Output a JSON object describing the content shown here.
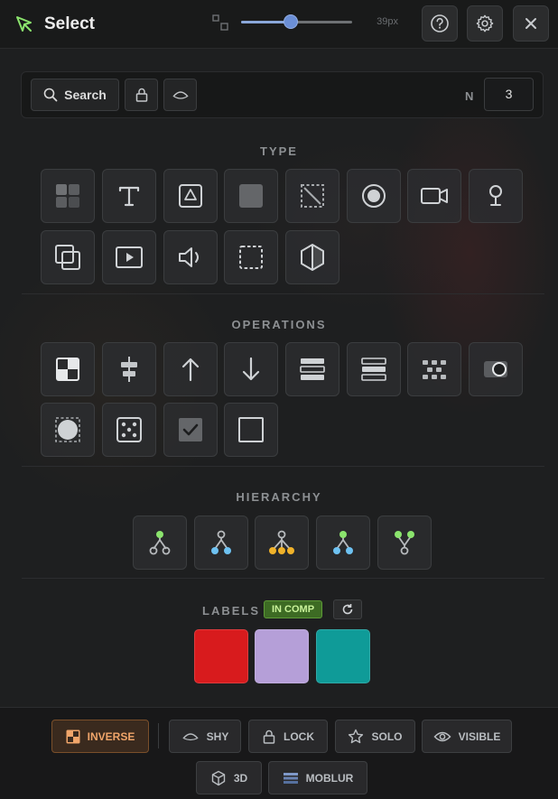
{
  "header": {
    "title": "Select",
    "title_icon": "cursor-arrow-icon",
    "zoom_icon": "zoom-squares-icon",
    "slider_value_label": "39px",
    "slider_fraction": 0.45,
    "buttons": [
      {
        "name": "help-button",
        "icon": "question-circle-icon"
      },
      {
        "name": "settings-button",
        "icon": "gear-icon"
      },
      {
        "name": "close-button",
        "icon": "close-icon"
      }
    ]
  },
  "search": {
    "label": "Search",
    "lock_icon": "lock-icon",
    "visibility_icon": "eye-closed-icon",
    "n_label": "N",
    "n_value": "3"
  },
  "sections": {
    "type": "TYPE",
    "operations": "OPERATIONS",
    "hierarchy": "HIERARCHY",
    "labels": "LABELS"
  },
  "type_tiles": [
    "precomp-icon",
    "text-layer-icon",
    "shape-layer-icon",
    "solid-layer-icon",
    "null-layer-icon",
    "adjustment-layer-icon",
    "camera-icon",
    "light-icon",
    "composition-icon",
    "video-footage-icon",
    "audio-icon",
    "guide-layer-icon",
    "3d-model-icon"
  ],
  "operation_tiles": [
    "invert-selection-icon",
    "align-center-icon",
    "select-above-icon",
    "select-below-icon",
    "select-layers-stack-icon",
    "select-layers-stack-alt-icon",
    "grid-dots-icon",
    "toggle-icon",
    "select-circle-icon",
    "random-dice-icon",
    "checkbox-checked-icon",
    "checkbox-empty-icon"
  ],
  "hierarchy_tiles": [
    "parent-node-icon",
    "children-node-icon",
    "all-children-icon",
    "siblings-node-icon",
    "root-merge-icon"
  ],
  "labels": {
    "badge": "IN COMP",
    "refresh_icon": "refresh-icon",
    "swatches": [
      "#d81b1d",
      "#b59fd8",
      "#0f9b98"
    ]
  },
  "colors": {
    "accent_green": "#8be46d",
    "accent_blue": "#6ec2f2",
    "accent_gold": "#f0b22a",
    "active_orange": "#f0a56a"
  },
  "bottom": {
    "row1": [
      {
        "label": "INVERSE",
        "icon": "inverse-icon",
        "active": true
      },
      {
        "label": "SHY",
        "icon": "shy-icon",
        "active": false
      },
      {
        "label": "LOCK",
        "icon": "lock-icon",
        "active": false
      },
      {
        "label": "SOLO",
        "icon": "star-icon",
        "active": false
      },
      {
        "label": "VISIBLE",
        "icon": "eye-icon",
        "active": false
      }
    ],
    "row2": [
      {
        "label": "3D",
        "icon": "cube-icon",
        "active": false
      },
      {
        "label": "MOBLUR",
        "icon": "motion-blur-icon",
        "active": false
      }
    ]
  }
}
